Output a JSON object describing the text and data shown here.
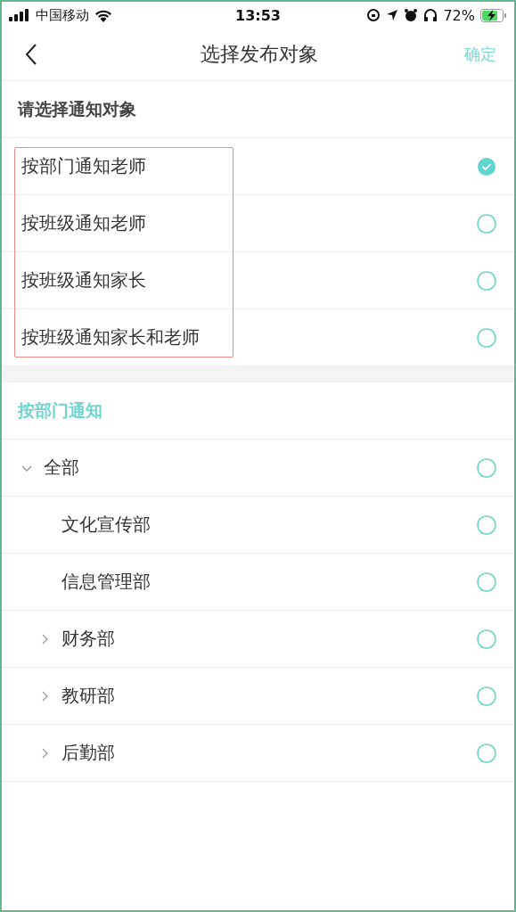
{
  "status_bar": {
    "carrier": "中国移动",
    "time": "13:53",
    "battery": "72%"
  },
  "header": {
    "title": "选择发布对象",
    "confirm": "确定"
  },
  "targets": {
    "title": "请选择通知对象",
    "options": [
      {
        "label": "按部门通知老师",
        "selected": true
      },
      {
        "label": "按班级通知老师",
        "selected": false
      },
      {
        "label": "按班级通知家长",
        "selected": false
      },
      {
        "label": "按班级通知家长和老师",
        "selected": false
      }
    ]
  },
  "departments": {
    "title": "按部门通知",
    "tree": [
      {
        "label": "全部",
        "kind": "branch",
        "expanded": true,
        "selected": false,
        "children": [
          {
            "label": "文化宣传部",
            "kind": "leaf",
            "selected": false
          },
          {
            "label": "信息管理部",
            "kind": "leaf",
            "selected": false
          },
          {
            "label": "财务部",
            "kind": "branch",
            "expanded": false,
            "selected": false
          },
          {
            "label": "教研部",
            "kind": "branch",
            "expanded": false,
            "selected": false
          },
          {
            "label": "后勤部",
            "kind": "branch",
            "expanded": false,
            "selected": false
          }
        ]
      }
    ]
  }
}
